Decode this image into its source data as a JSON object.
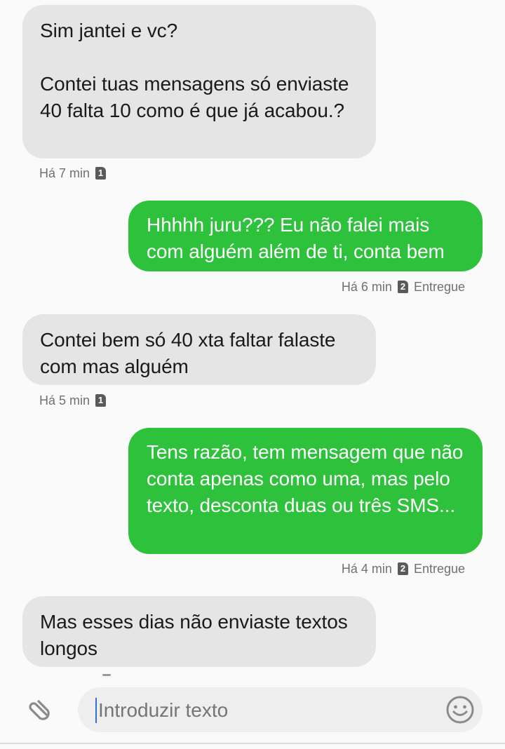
{
  "thread": {
    "messages": [
      {
        "direction": "incoming",
        "text": "Sim jantei e vc?\n\nContei tuas mensagens só enviaste 40 falta 10 como é que já acabou.?",
        "time": "Há 7 min",
        "sim": "1",
        "status": ""
      },
      {
        "direction": "outgoing",
        "text": "Hhhhh juru??? Eu não falei mais com alguém além de ti, conta bem",
        "time": "Há 6 min",
        "sim": "2",
        "status": "Entregue"
      },
      {
        "direction": "incoming",
        "text": "Contei bem só 40 xta faltar falaste com mas alguém",
        "time": "Há 5 min",
        "sim": "1",
        "status": ""
      },
      {
        "direction": "outgoing",
        "text": "Tens razão, tem mensagem que não conta apenas como uma, mas pelo texto, desconta duas ou três SMS...",
        "time": "Há 4 min",
        "sim": "2",
        "status": "Entregue"
      },
      {
        "direction": "incoming",
        "text": "Mas esses dias não enviaste textos longos",
        "time": "",
        "sim": "",
        "status": ""
      }
    ]
  },
  "composer": {
    "placeholder": "Introduzir texto",
    "attach_icon": "paperclip-icon",
    "emoji_icon": "smiley-icon"
  },
  "colors": {
    "incoming_bubble": "#e5e5e5",
    "outgoing_bubble": "#2ec13c",
    "meta_text": "#707070",
    "caret": "#2f6fd6"
  }
}
